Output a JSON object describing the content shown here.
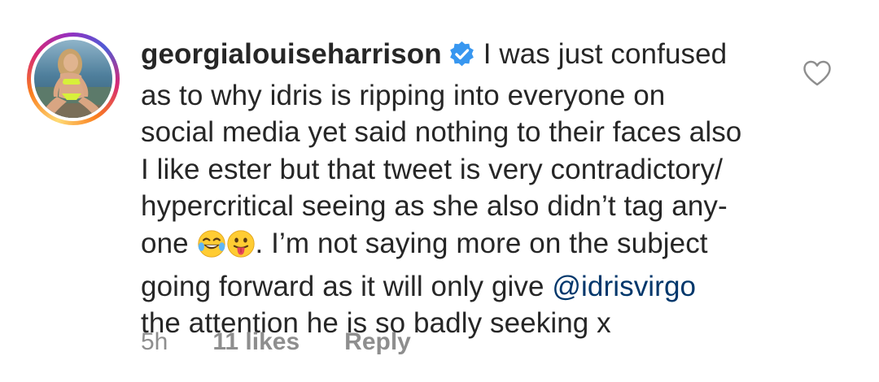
{
  "comment": {
    "username": "georgialouiseharrison",
    "verified": true,
    "text_lines": [
      "I was just confused",
      "as to why idris is ripping into everyone on",
      "social media yet said nothing to their faces also",
      "I like ester but that tweet is very contradictory/",
      "hypercritical seeing as she also didn’t tag any-",
      "one",
      ". I’m not saying more on the subject",
      "going forward as it will only give ",
      "@idrisvirgo",
      "the attention he is so badly seeking x"
    ],
    "emojis": [
      "face-with-tears-of-joy",
      "face-with-tongue"
    ],
    "time": "5h",
    "likes": "11 likes",
    "reply_label": "Reply"
  },
  "icons": {
    "verified": "verified-badge-icon",
    "heart": "heart-outline-icon"
  },
  "colors": {
    "text": "#262626",
    "meta": "#8e8e8e",
    "mention": "#00376b",
    "verified": "#3897f0",
    "heart_stroke": "#8e8e8e"
  }
}
